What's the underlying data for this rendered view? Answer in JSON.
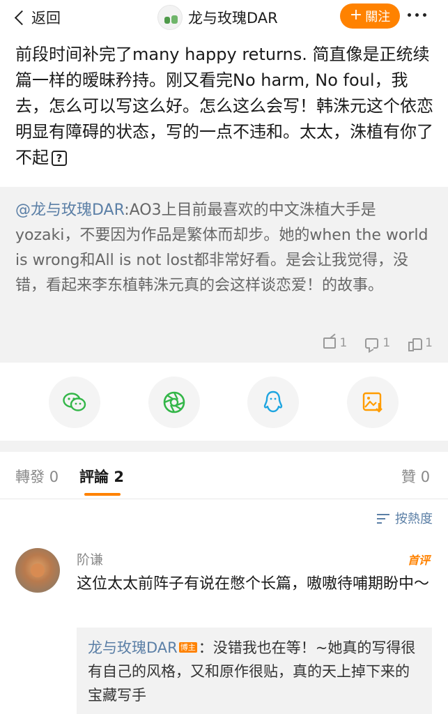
{
  "header": {
    "back_label": "返回",
    "title": "龙与玫瑰DAR",
    "follow_label": "關注",
    "follow_plus": "+",
    "accent_color": "#ff8200"
  },
  "post": {
    "text": "前段时间补完了many happy returns. 简直像是正统续篇一样的暧昧矜持。刚又看完No harm, No foul，我去，怎么可以写这么好。怎么这么会写！韩洙元这个依恋明显有障碍的状态，写的一点不违和。太太，洙植有你了不起",
    "inline_icon": "?"
  },
  "repost": {
    "mention": "@龙与玫瑰DAR",
    "text": ":AO3上目前最喜欢的中文洙植大手是yozaki，不要因为作品是繁体而却步。她的when the world is wrong和All is not lost都非常好看。是会让我觉得，没错，看起来李东植韩洙元真的会这样谈恋爱！的故事。",
    "share_count": "1",
    "comment_count": "1",
    "like_count": "1"
  },
  "share_targets": [
    {
      "name": "wechat-icon",
      "color": "#33b648"
    },
    {
      "name": "moments-icon",
      "color": "#33b648"
    },
    {
      "name": "qq-icon",
      "color": "#1ea5e0"
    },
    {
      "name": "save-image-icon",
      "color": "#ff9c00"
    }
  ],
  "tabs": {
    "repost_label": "轉發",
    "repost_count": "0",
    "comment_label": "評論",
    "comment_count": "2",
    "like_label": "贊",
    "like_count": "0"
  },
  "sort": {
    "label": "按熱度"
  },
  "comment": {
    "author": "阶谦",
    "badge": "首评",
    "text": "这位太太前阵子有说在憋个长篇，嗷嗷待哺期盼中～",
    "reply": {
      "author": "龙与玫瑰DAR",
      "tag": "博主",
      "text": "：没错我也在等！~她真的写得很有自己的风格，又和原作很贴，真的天上掉下来的宝藏写手"
    }
  }
}
